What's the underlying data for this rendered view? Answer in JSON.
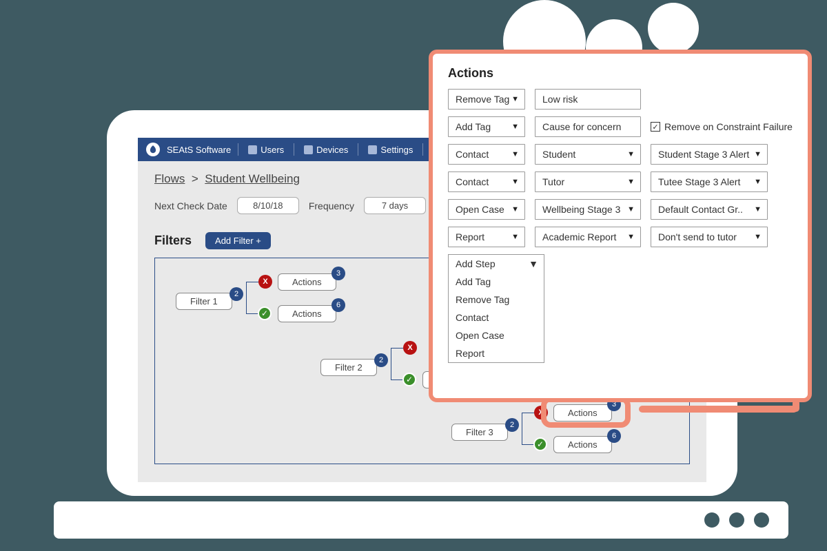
{
  "brand": "SEAtS Software",
  "nav": {
    "users": "Users",
    "devices": "Devices",
    "settings": "Settings"
  },
  "breadcrumb": {
    "root": "Flows",
    "sep": ">",
    "current": "Student Wellbeing"
  },
  "controls": {
    "nextCheckLabel": "Next Check Date",
    "nextCheckValue": "8/10/18",
    "freqLabel": "Frequency",
    "freqValue": "7 days"
  },
  "filters": {
    "title": "Filters",
    "addButton": "Add Filter +"
  },
  "flow": {
    "filter1": "Filter 1",
    "filter2": "Filter 2",
    "filter3": "Filter 3",
    "actions": "Actions",
    "badge2": "2",
    "badge3": "3",
    "badge6": "6",
    "x": "X",
    "check": "✓"
  },
  "popover": {
    "title": "Actions",
    "rows": [
      {
        "a": "Remove Tag",
        "b": "Low risk"
      },
      {
        "a": "Add Tag",
        "b": "Cause for concern",
        "c_checkbox": "Remove on Constraint Failure",
        "c_checked": true
      },
      {
        "a": "Contact",
        "b": "Student",
        "c": "Student Stage 3 Alert"
      },
      {
        "a": "Contact",
        "b": "Tutor",
        "c": "Tutee Stage 3 Alert"
      },
      {
        "a": "Open Case",
        "b": "Wellbeing Stage 3",
        "c": "Default Contact Gr.."
      },
      {
        "a": "Report",
        "b": "Academic Report",
        "c": "Don't send to tutor"
      }
    ],
    "stepMenu": {
      "header": "Add Step",
      "items": [
        "Add Tag",
        "Remove Tag",
        "Contact",
        "Open Case",
        "Report"
      ]
    }
  }
}
